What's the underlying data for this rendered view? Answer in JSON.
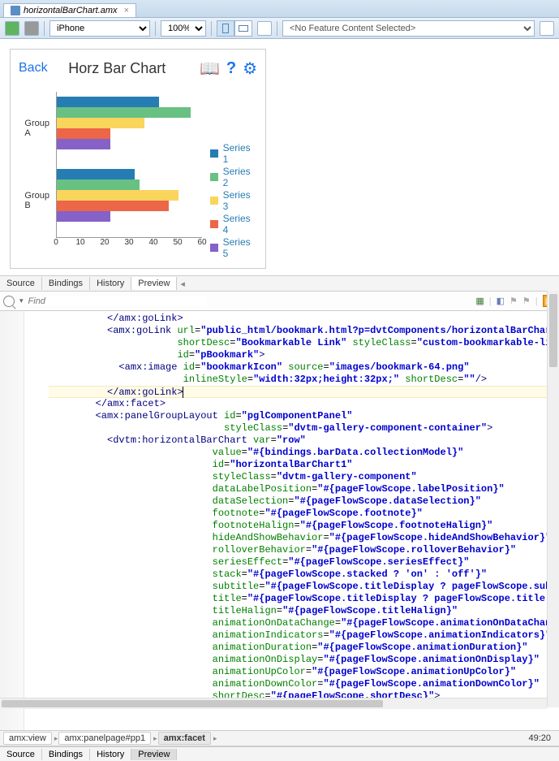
{
  "file_tab": {
    "name": "horizontalBarChart.amx",
    "close": "×"
  },
  "toolbar": {
    "device": "iPhone",
    "zoom": "100%",
    "feature": "<No Feature Content Selected>"
  },
  "app": {
    "back": "Back",
    "title": "Horz Bar Chart",
    "bookmark_glyph": "📖",
    "help_glyph": "?",
    "gear_glyph": "⚙"
  },
  "chart_data": {
    "type": "bar",
    "orientation": "horizontal",
    "categories": [
      "Group A",
      "Group B"
    ],
    "series": [
      {
        "name": "Series 1",
        "values": [
          42,
          32
        ],
        "color": "#267db3"
      },
      {
        "name": "Series 2",
        "values": [
          55,
          34
        ],
        "color": "#68c182"
      },
      {
        "name": "Series 3",
        "values": [
          36,
          50
        ],
        "color": "#fad55c"
      },
      {
        "name": "Series 4",
        "values": [
          22,
          46
        ],
        "color": "#ed6647"
      },
      {
        "name": "Series 5",
        "values": [
          22,
          22
        ],
        "color": "#8561c8"
      }
    ],
    "xlim": [
      0,
      60
    ],
    "xticks": [
      0,
      10,
      20,
      30,
      40,
      50,
      60
    ]
  },
  "pane_tabs": [
    "Source",
    "Bindings",
    "History",
    "Preview"
  ],
  "pane_active": "Preview",
  "find_placeholder": "Find",
  "code": {
    "lines": [
      {
        "indent": 10,
        "text": "</amx:goLink>"
      },
      {
        "indent": 10,
        "text": "<amx:goLink url=\"public_html/bookmark.html?p=dvtComponents/horizontalBarChart\""
      },
      {
        "indent": 22,
        "text": "shortDesc=\"Bookmarkable Link\" styleClass=\"custom-bookmarkable-link\""
      },
      {
        "indent": 22,
        "text": "id=\"pBookmark\">"
      },
      {
        "indent": 12,
        "text": "<amx:image id=\"bookmarkIcon\" source=\"images/bookmark-64.png\""
      },
      {
        "indent": 23,
        "text": "inlineStyle=\"width:32px;height:32px;\" shortDesc=\"\"/>"
      },
      {
        "indent": 10,
        "text": "</amx:goLink>",
        "hl": true
      },
      {
        "indent": 8,
        "text": "</amx:facet>"
      },
      {
        "indent": 8,
        "text": "<amx:panelGroupLayout id=\"pglComponentPanel\""
      },
      {
        "indent": 30,
        "text": "styleClass=\"dvtm-gallery-component-container\">"
      },
      {
        "indent": 10,
        "text": "<dvtm:horizontalBarChart var=\"row\""
      },
      {
        "indent": 28,
        "text": "value=\"#{bindings.barData.collectionModel}\""
      },
      {
        "indent": 28,
        "text": "id=\"horizontalBarChart1\""
      },
      {
        "indent": 28,
        "text": "styleClass=\"dvtm-gallery-component\""
      },
      {
        "indent": 28,
        "text": "dataLabelPosition=\"#{pageFlowScope.labelPosition}\""
      },
      {
        "indent": 28,
        "text": "dataSelection=\"#{pageFlowScope.dataSelection}\""
      },
      {
        "indent": 28,
        "text": "footnote=\"#{pageFlowScope.footnote}\""
      },
      {
        "indent": 28,
        "text": "footnoteHalign=\"#{pageFlowScope.footnoteHalign}\""
      },
      {
        "indent": 28,
        "text": "hideAndShowBehavior=\"#{pageFlowScope.hideAndShowBehavior}\""
      },
      {
        "indent": 28,
        "text": "rolloverBehavior=\"#{pageFlowScope.rolloverBehavior}\""
      },
      {
        "indent": 28,
        "text": "seriesEffect=\"#{pageFlowScope.seriesEffect}\""
      },
      {
        "indent": 28,
        "text": "stack=\"#{pageFlowScope.stacked ? 'on' : 'off'}\""
      },
      {
        "indent": 28,
        "text": "subtitle=\"#{pageFlowScope.titleDisplay ? pageFlowScope.subtitle : ''}\""
      },
      {
        "indent": 28,
        "text": "title=\"#{pageFlowScope.titleDisplay ? pageFlowScope.title : ''}\""
      },
      {
        "indent": 28,
        "text": "titleHalign=\"#{pageFlowScope.titleHalign}\""
      },
      {
        "indent": 28,
        "text": "animationOnDataChange=\"#{pageFlowScope.animationOnDataChange}\""
      },
      {
        "indent": 28,
        "text": "animationIndicators=\"#{pageFlowScope.animationIndicators}\""
      },
      {
        "indent": 28,
        "text": "animationDuration=\"#{pageFlowScope.animationDuration}\""
      },
      {
        "indent": 28,
        "text": "animationOnDisplay=\"#{pageFlowScope.animationOnDisplay}\""
      },
      {
        "indent": 28,
        "text": "animationUpColor=\"#{pageFlowScope.animationUpColor}\""
      },
      {
        "indent": 28,
        "text": "animationDownColor=\"#{pageFlowScope.animationDownColor}\""
      },
      {
        "indent": 28,
        "text": "shortDesc=\"#{pageFlowScope.shortDesc}\">"
      }
    ]
  },
  "breadcrumb": {
    "items": [
      "amx:view",
      "amx:panelpage#pp1",
      "amx:facet"
    ],
    "active": "amx:facet",
    "line_col": "49:20"
  },
  "bottom_tabs": [
    "Source",
    "Bindings",
    "History",
    "Preview"
  ],
  "bottom_active": "Preview",
  "chev": "▸"
}
